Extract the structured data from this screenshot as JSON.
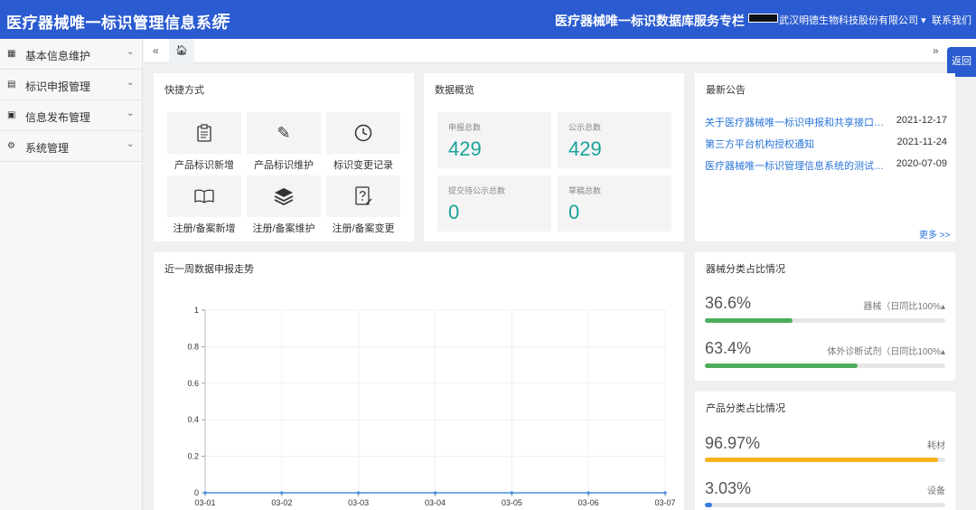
{
  "header": {
    "app_title": "医疗器械唯一标识管理信息系统",
    "db_link": "医疗器械唯一标识数据库服务专栏",
    "company": "武汉明德生物科技股份有限公司",
    "contact": "联系我们"
  },
  "sidebar": {
    "items": [
      {
        "label": "基本信息维护",
        "icon": "grid-icon"
      },
      {
        "label": "标识申报管理",
        "icon": "table-icon"
      },
      {
        "label": "信息发布管理",
        "icon": "id-card-icon"
      },
      {
        "label": "系统管理",
        "icon": "gears-icon"
      }
    ]
  },
  "tabs": {
    "back_label": "返回"
  },
  "shortcuts": {
    "title": "快捷方式",
    "items": [
      {
        "label": "产品标识新增",
        "icon": "clipboard-icon"
      },
      {
        "label": "产品标识维护",
        "icon": "pencil-icon"
      },
      {
        "label": "标识变更记录",
        "icon": "clock-icon"
      },
      {
        "label": "注册/备案新增",
        "icon": "book-icon"
      },
      {
        "label": "注册/备案维护",
        "icon": "layers-icon"
      },
      {
        "label": "注册/备案变更",
        "icon": "question-doc-icon"
      }
    ]
  },
  "overview": {
    "title": "数据概览",
    "stats": [
      {
        "label": "申报总数",
        "value": "429"
      },
      {
        "label": "公示总数",
        "value": "429"
      },
      {
        "label": "提交待公示总数",
        "value": "0"
      },
      {
        "label": "草稿总数",
        "value": "0"
      }
    ]
  },
  "notices": {
    "title": "最新公告",
    "items": [
      {
        "title": "关于医疗器械唯一标识申报和共享接口新增",
        "date": "2021-12-17"
      },
      {
        "title": "第三方平台机构授权通知",
        "date": "2021-11-24"
      },
      {
        "title": "医疗器械唯一标识管理信息系统的测试环境",
        "date": "2020-07-09"
      }
    ],
    "more": "更多 >>"
  },
  "trend": {
    "title": "近一周数据申报走势"
  },
  "chart_data": {
    "type": "line",
    "x": [
      "03-01",
      "03-02",
      "03-03",
      "03-04",
      "03-05",
      "03-06",
      "03-07"
    ],
    "series": [
      {
        "values": [
          0,
          0,
          0,
          0,
          0,
          0,
          0
        ]
      }
    ],
    "ylim": [
      0,
      1
    ],
    "yticks": [
      "0",
      "0.2",
      "0.4",
      "0.6",
      "0.8",
      "1"
    ],
    "grid": true
  },
  "device_class": {
    "title": "器械分类占比情况",
    "items": [
      {
        "pct": "36.6%",
        "label": "器械（日同比100%",
        "fraction": 0.366,
        "color": "#4cae5c"
      },
      {
        "pct": "63.4%",
        "label": "体外诊断试剂（日同比100%",
        "fraction": 0.634,
        "color": "#4cae5c"
      }
    ]
  },
  "product_class": {
    "title": "产品分类占比情况",
    "items": [
      {
        "pct": "96.97%",
        "label": "耗材",
        "fraction": 0.9697,
        "color": "#f5b21d"
      },
      {
        "pct": "3.03%",
        "label": "设备",
        "fraction": 0.0303,
        "color": "#3a7be0"
      }
    ]
  }
}
